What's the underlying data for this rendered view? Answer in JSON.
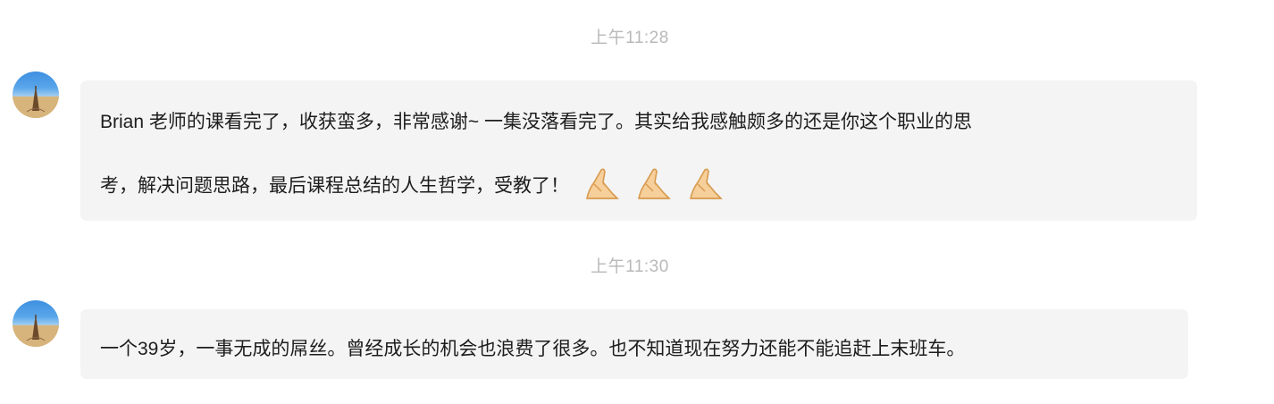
{
  "timestamps": [
    "上午11:28",
    "上午11:30"
  ],
  "messages": [
    {
      "lines": [
        "Brian 老师的课看完了，收获蛮多，非常感谢~ 一集没落看完了。其实给我感触颇多的还是你这个职业的思",
        "考，解决问题思路，最后课程总结的人生哲学，受教了！"
      ],
      "emoji": [
        "pray-emoji",
        "pray-emoji",
        "pray-emoji"
      ]
    },
    {
      "lines": [
        "一个39岁，一事无成的屌丝。曾经成长的机会也浪费了很多。也不知道现在努力还能不能追赶上末班车。"
      ]
    }
  ],
  "colors": {
    "bubble": "#f4f4f4",
    "timestamp": "#b9b9b9",
    "text": "#1d1d1d"
  }
}
